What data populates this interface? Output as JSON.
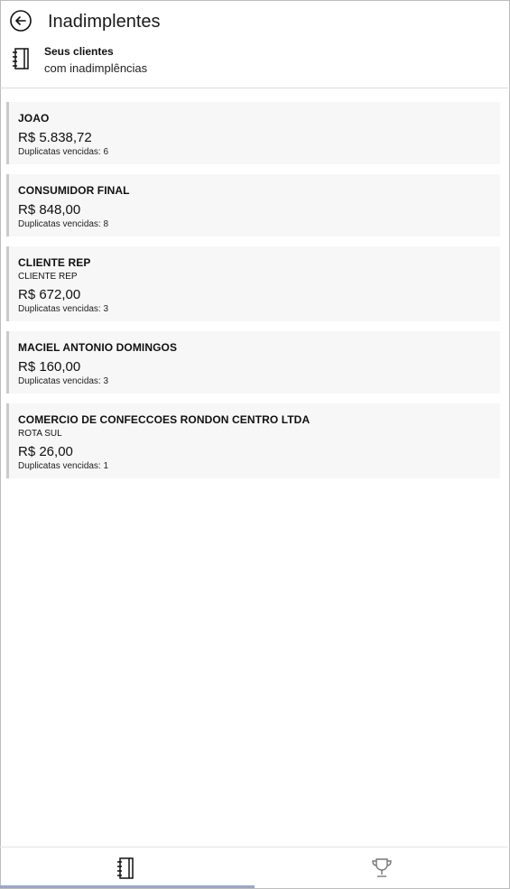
{
  "header": {
    "title": "Inadimplentes",
    "subtitle_bold": "Seus clientes",
    "subtitle": "com inadimplências"
  },
  "clients": [
    {
      "name": "JOAO",
      "route": "",
      "amount": "R$ 5.838,72",
      "overdue": "Duplicatas vencidas: 6"
    },
    {
      "name": "CONSUMIDOR FINAL",
      "route": "",
      "amount": "R$ 848,00",
      "overdue": "Duplicatas vencidas: 8"
    },
    {
      "name": "CLIENTE REP",
      "route": "CLIENTE REP",
      "amount": "R$ 672,00",
      "overdue": "Duplicatas vencidas: 3"
    },
    {
      "name": "MACIEL ANTONIO DOMINGOS",
      "route": "",
      "amount": "R$ 160,00",
      "overdue": "Duplicatas vencidas: 3"
    },
    {
      "name": "COMERCIO DE CONFECCOES RONDON CENTRO LTDA",
      "route": "ROTA SUL",
      "amount": "R$ 26,00",
      "overdue": "Duplicatas vencidas: 1"
    }
  ],
  "bottom_nav": {
    "items": [
      {
        "icon": "notebook-icon",
        "active": true
      },
      {
        "icon": "trophy-icon",
        "active": false
      }
    ]
  },
  "colors": {
    "card_bg": "#f7f7f7",
    "card_accent": "#c9c9c9",
    "active_indicator": "#9aa6c8"
  }
}
